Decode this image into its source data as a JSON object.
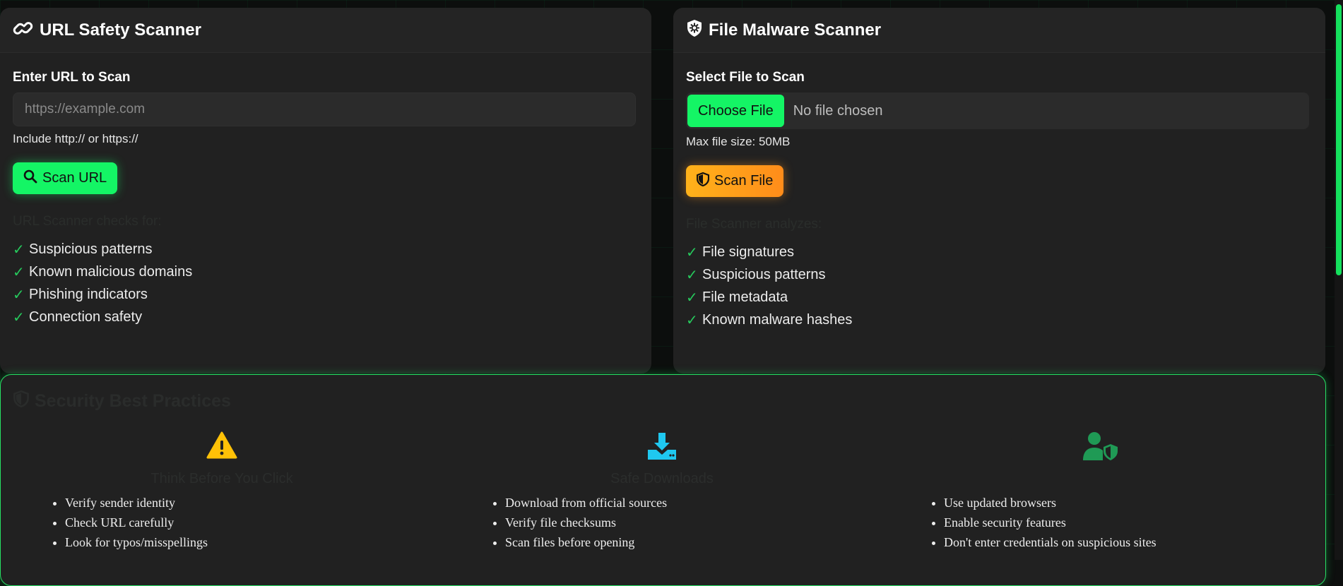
{
  "url_scanner": {
    "title": "URL Safety Scanner",
    "icon": "link-icon",
    "field_label": "Enter URL to Scan",
    "placeholder": "https://example.com",
    "hint": "Include http:// or https://",
    "button_label": "Scan URL",
    "checks_heading": "URL Scanner checks for:",
    "checks": [
      "Suspicious patterns",
      "Known malicious domains",
      "Phishing indicators",
      "Connection safety"
    ]
  },
  "file_scanner": {
    "title": "File Malware Scanner",
    "icon": "shield-virus-icon",
    "field_label": "Select File to Scan",
    "choose_label": "Choose File",
    "no_file_text": "No file chosen",
    "hint": "Max file size: 50MB",
    "button_label": "Scan File",
    "checks_heading": "File Scanner analyzes:",
    "checks": [
      "File signatures",
      "Suspicious patterns",
      "File metadata",
      "Known malware hashes"
    ]
  },
  "practices": {
    "title": "Security Best Practices",
    "columns": [
      {
        "icon": "warning-icon",
        "color": "#ffc107",
        "heading": "Think Before You Click",
        "items": [
          "Verify sender identity",
          "Check URL carefully",
          "Look for typos/misspellings"
        ]
      },
      {
        "icon": "download-icon",
        "color": "#1fc8f0",
        "heading": "Safe Downloads",
        "items": [
          "Download from official sources",
          "Verify file checksums",
          "Scan files before opening"
        ]
      },
      {
        "icon": "user-shield-icon",
        "color": "#1f9a55",
        "heading": "",
        "items": [
          "Use updated browsers",
          "Enable security features",
          "Don't enter credentials on suspicious sites"
        ]
      }
    ]
  },
  "colors": {
    "accent": "#14f565",
    "warning": "#ffb21a",
    "check": "#26c95c"
  }
}
